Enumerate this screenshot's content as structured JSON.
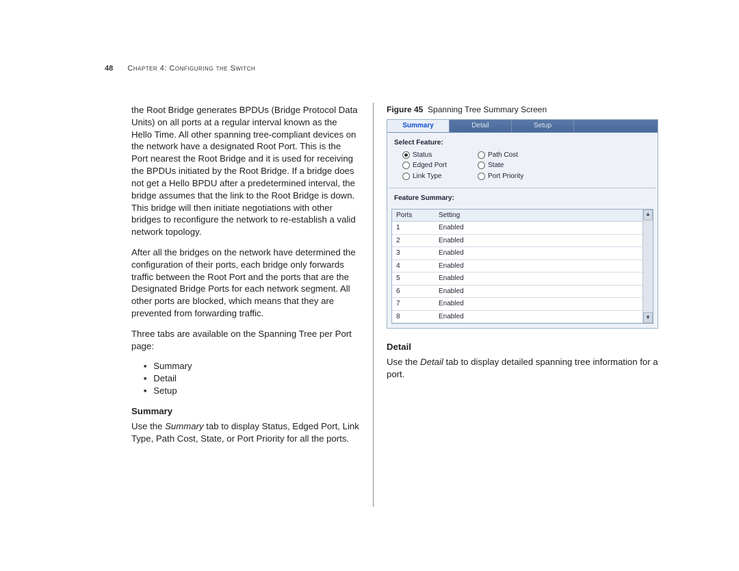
{
  "header": {
    "page_number": "48",
    "chapter": "Chapter 4: Configuring the Switch"
  },
  "left": {
    "p1": "the Root Bridge generates BPDUs (Bridge Protocol Data Units) on all ports at a regular interval known as the Hello Time. All other spanning tree-compliant devices on the network have a designated Root Port. This is the Port nearest the Root Bridge and it is used for receiving the BPDUs initiated by the Root Bridge. If a bridge does not get a Hello BPDU after a predetermined interval, the bridge assumes that the link to the Root Bridge is down. This bridge will then initiate negotiations with other bridges to reconfigure the network to re-establish a valid network topology.",
    "p2": "After all the bridges on the network have determined the configuration of their ports, each bridge only forwards traffic between the Root Port and the ports that are the Designated Bridge Ports for each network segment. All other ports are blocked, which means that they are prevented from forwarding traffic.",
    "p3": "Three tabs are available on the Spanning Tree per Port page:",
    "bullets": [
      "Summary",
      "Detail",
      "Setup"
    ],
    "h_summary": "Summary",
    "p4a": "Use the ",
    "p4b": "Summary",
    "p4c": " tab to display Status, Edged Port, Link Type, Path Cost, State, or Port Priority for all the ports."
  },
  "figure": {
    "label": "Figure 45",
    "caption": "Spanning Tree Summary Screen",
    "tabs": {
      "summary": "Summary",
      "detail": "Detail",
      "setup": "Setup"
    },
    "select_feature_label": "Select Feature:",
    "radios": {
      "status": "Status",
      "path_cost": "Path Cost",
      "edged_port": "Edged Port",
      "state": "State",
      "link_type": "Link Type",
      "port_priority": "Port Priority"
    },
    "feature_summary_label": "Feature Summary:",
    "table": {
      "col1": "Ports",
      "col2": "Setting",
      "rows": [
        {
          "port": "1",
          "setting": "Enabled"
        },
        {
          "port": "2",
          "setting": "Enabled"
        },
        {
          "port": "3",
          "setting": "Enabled"
        },
        {
          "port": "4",
          "setting": "Enabled"
        },
        {
          "port": "5",
          "setting": "Enabled"
        },
        {
          "port": "6",
          "setting": "Enabled"
        },
        {
          "port": "7",
          "setting": "Enabled"
        },
        {
          "port": "8",
          "setting": "Enabled"
        }
      ]
    }
  },
  "right": {
    "h_detail": "Detail",
    "p1a": "Use the ",
    "p1b": "Detail",
    "p1c": " tab to display detailed spanning tree information for a port."
  }
}
